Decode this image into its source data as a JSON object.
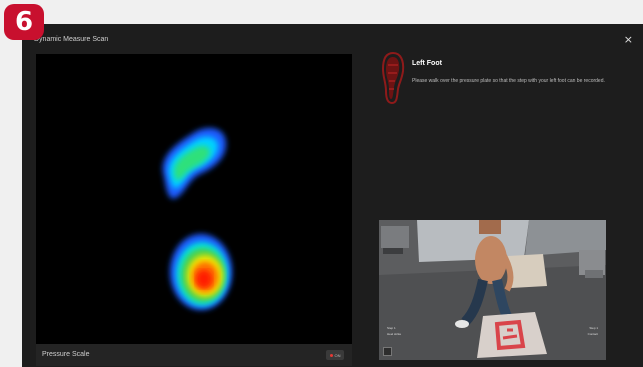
{
  "step_badge": "6",
  "window": {
    "title": "Dynamic Measure Scan",
    "close_label": "×"
  },
  "heatmap": {
    "scale_label": "Pressure Scale",
    "scale_toggle": "ON"
  },
  "instruction": {
    "title": "Left Foot",
    "text": "Please walk over the pressure plate so that the step with your left foot can be recorded."
  },
  "camera": {
    "left_label": "Step 1",
    "left_sublabel": "Heel strike",
    "right_label": "Step 1",
    "right_sublabel": "Contact"
  },
  "colors": {
    "accent": "#c8102e",
    "window_bg": "#1d1d1d",
    "heatmap_bg": "#000000"
  }
}
